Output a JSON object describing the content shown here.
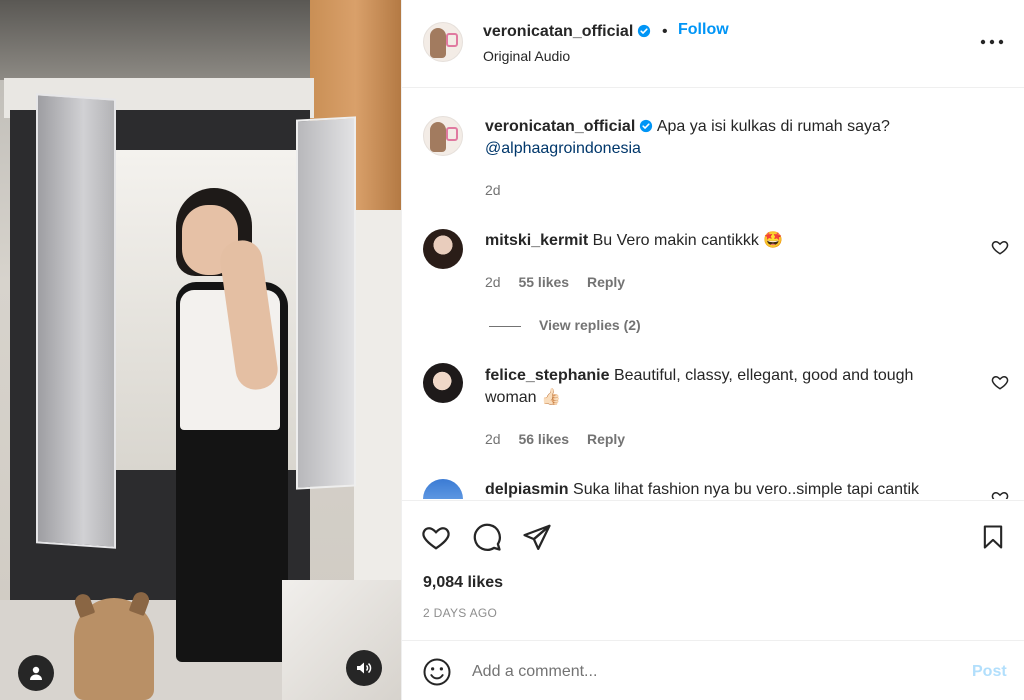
{
  "post": {
    "author": "veronicatan_official",
    "follow_label": "Follow",
    "dot": "•",
    "audio_label": "Original Audio"
  },
  "caption": {
    "author": "veronicatan_official",
    "text": "Apa ya isi kulkas di rumah saya?",
    "mention": "@alphaagroindonesia",
    "time": "2d"
  },
  "comments": [
    {
      "user": "mitski_kermit",
      "text": "Bu Vero makin cantikkk",
      "emoji": "🤩",
      "time": "2d",
      "likes": "55 likes",
      "reply": "Reply",
      "view_replies": "View replies (2)"
    },
    {
      "user": "felice_stephanie",
      "text": "Beautiful, classy, ellegant, good and tough woman",
      "emoji": "👍🏻",
      "time": "2d",
      "likes": "56 likes",
      "reply": "Reply"
    },
    {
      "user": "delpiasmin",
      "text": "Suka lihat fashion nya bu vero..simple tapi cantik"
    }
  ],
  "stats": {
    "likes": "9,084 likes",
    "date": "2 DAYS AGO"
  },
  "composer": {
    "placeholder": "Add a comment...",
    "post_label": "Post"
  },
  "colors": {
    "link_blue": "#0095f6",
    "post_disabled": "#b2dffc",
    "mention": "#00376b",
    "verified": "#0095f6"
  },
  "icons": {
    "more": "more-horizontal-icon",
    "like": "heart-icon",
    "comment": "comment-bubble-icon",
    "share": "paper-plane-icon",
    "save": "bookmark-icon",
    "emoji": "emoji-smile-icon",
    "user_tag": "user-tag-icon",
    "audio": "speaker-icon"
  }
}
